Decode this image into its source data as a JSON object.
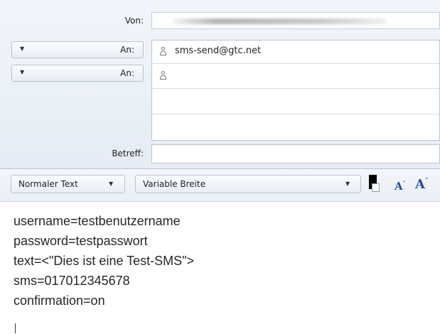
{
  "header": {
    "from_label": "Von:",
    "to_label_1": "An:",
    "to_label_2": "An:",
    "subject_label": "Betreff:",
    "recipients": [
      "sms-send@gtc.net",
      ""
    ],
    "subject_value": ""
  },
  "toolbar": {
    "style_select": "Normaler Text",
    "font_select": "Variable Breite"
  },
  "body": {
    "lines": [
      "username=testbenutzername",
      "password=testpasswort",
      "text=<\"Dies ist eine Test-SMS\">",
      "sms=017012345678",
      "confirmation=on"
    ]
  },
  "icons": {
    "recipient": "person-icon",
    "text_color": "text-color-icon",
    "smaller_font": "decrease-font-icon",
    "larger_font": "increase-font-icon"
  },
  "colors": {
    "header_bg": "#e9eef5",
    "font_icon": "#1f4fa3",
    "text": "#262626"
  }
}
